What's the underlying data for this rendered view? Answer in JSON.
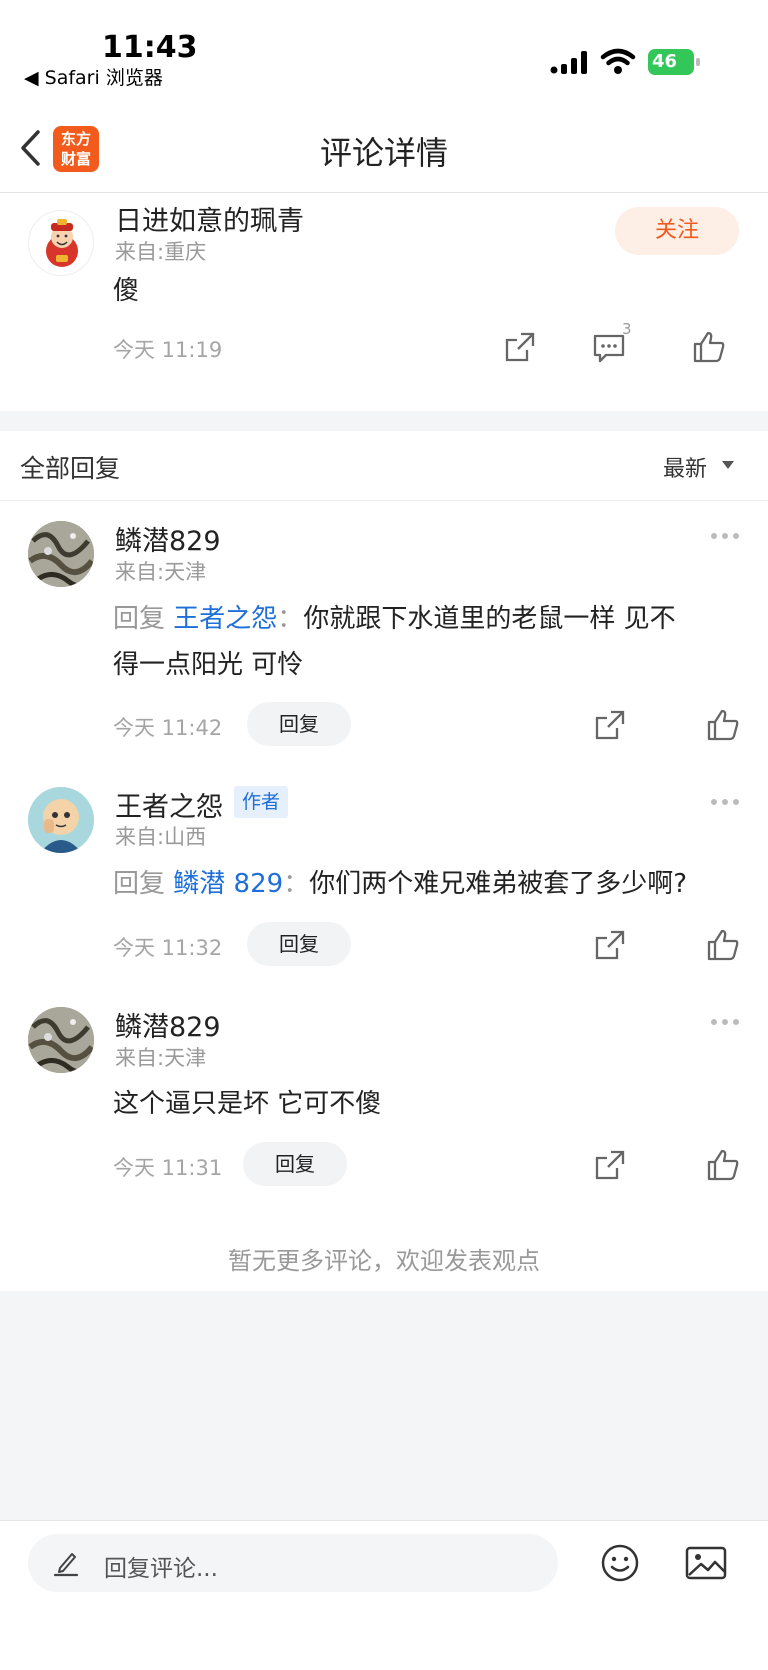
{
  "status_bar": {
    "time": "11:43",
    "back_app": "◀ Safari 浏览器",
    "battery": "46"
  },
  "nav": {
    "title": "评论详情",
    "logo_line1": "东方",
    "logo_line2": "财富"
  },
  "main_comment": {
    "username": "日进如意的珮青",
    "location": "来自:重庆",
    "follow_label": "关注",
    "text": "傻",
    "time": "今天 11:19",
    "reply_count": "3"
  },
  "replies_header": {
    "title": "全部回复",
    "sort": "最新"
  },
  "replies": [
    {
      "username": "鳞潜829",
      "location": "来自:天津",
      "reply_prefix": "回复",
      "reply_target": "王者之怨",
      "colon": "：",
      "text_line1": "你就跟下水道里的老鼠一样 见不",
      "text_line2": "得一点阳光 可怜",
      "time": "今天 11:42",
      "reply_label": "回复"
    },
    {
      "username": "王者之怨",
      "badge": "作者",
      "location": "来自:山西",
      "reply_prefix": "回复",
      "reply_target": "鳞潜 829",
      "colon": "：",
      "text": "你们两个难兄难弟被套了多少啊?",
      "time": "今天 11:32",
      "reply_label": "回复"
    },
    {
      "username": "鳞潜829",
      "location": "来自:天津",
      "text": "这个逼只是坏 它可不傻",
      "time": "今天 11:31",
      "reply_label": "回复"
    }
  ],
  "footer_note": "暂无更多评论，欢迎发表观点",
  "bottom_bar": {
    "placeholder": "回复评论..."
  },
  "colors": {
    "accent": "#f25b1b",
    "link": "#1e6fd9"
  }
}
